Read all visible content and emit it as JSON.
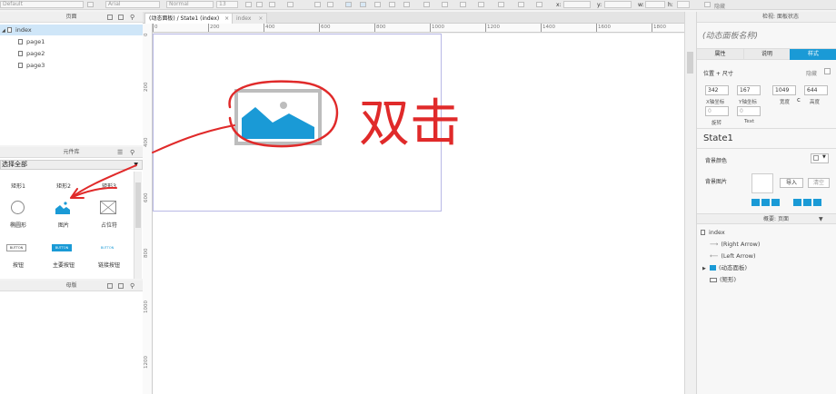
{
  "toolbar": {
    "style_select": "Default",
    "font_select": "Arial",
    "weight_select": "Normal",
    "size_select": "13",
    "x_label": "x:",
    "y_label": "y:",
    "w_label": "w:",
    "h_label": "h:",
    "hidden_label": "隐藏"
  },
  "pages_panel": {
    "title": "页面",
    "items": [
      {
        "label": "index",
        "selected": true
      },
      {
        "label": "page1"
      },
      {
        "label": "page2"
      },
      {
        "label": "page3"
      }
    ]
  },
  "library_panel": {
    "title": "元件库",
    "select_all": "选择全部",
    "widgets_row1": [
      "矩形1",
      "矩形2",
      "矩形3"
    ],
    "widgets_row2": [
      "椭圆形",
      "图片",
      "占位符"
    ],
    "widgets_row3": [
      "按钮",
      "主要按钮",
      "链接按钮"
    ],
    "button_text": "BUTTON"
  },
  "masters_panel": {
    "title": "母版"
  },
  "tabs": [
    {
      "label": "(动态面板) / State1 (index)",
      "active": true
    },
    {
      "label": "index",
      "active": false
    }
  ],
  "ruler": {
    "top": [
      "0",
      "200",
      "400",
      "600",
      "800",
      "1000",
      "1200",
      "1400",
      "1600",
      "1800"
    ],
    "left": [
      "0",
      "200",
      "400",
      "600",
      "800",
      "1000",
      "1200"
    ]
  },
  "annotation": {
    "text": "双击"
  },
  "inspector": {
    "header": "检视: 面板状态",
    "panel_name": "(动态面板名称)",
    "tabs": [
      "属性",
      "说明",
      "样式"
    ],
    "position_size": "位置 + 尺寸",
    "hide": "隐藏",
    "x_value": "342",
    "y_value": "167",
    "w_value": "1049",
    "h_value": "644",
    "x_label": "X轴坐标",
    "y_label": "Y轴坐标",
    "width_label": "宽度",
    "height_label": "高度",
    "rotate_value": "0",
    "text_rotate_value": "0",
    "rotate_label": "旋转",
    "text_label": "Text",
    "state_name": "State1",
    "bg_color": "背景颜色",
    "bg_image": "背景图片",
    "import_btn": "导入",
    "clear_btn": "清空"
  },
  "outline": {
    "title": "概要: 页面",
    "items": [
      "index",
      "(Right Arrow)",
      "(Left Arrow)",
      "(动态面板)",
      "(矩形)"
    ]
  },
  "colors": {
    "accent": "#1a9ad6",
    "annotation": "#e02a2a"
  }
}
